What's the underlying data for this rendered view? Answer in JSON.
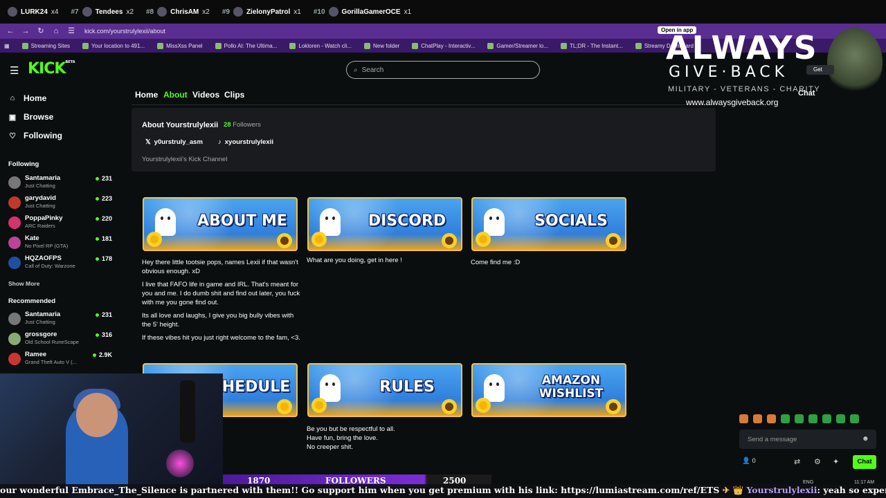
{
  "leaderboard": [
    {
      "rank": "",
      "name": "LURK24",
      "count": "x4"
    },
    {
      "rank": "#7",
      "name": "Tendees",
      "count": "x2"
    },
    {
      "rank": "#8",
      "name": "ChrisAM",
      "count": "x2"
    },
    {
      "rank": "#9",
      "name": "ZielonyPatrol",
      "count": "x1"
    },
    {
      "rank": "#10",
      "name": "GorillaGamerOCE",
      "count": "x1"
    }
  ],
  "browser": {
    "url": "kick.com/yourstrulylexii/about",
    "open_in_app": "Open in app"
  },
  "bookmarks": [
    "Streaming Sites",
    "Your location to 491...",
    "MissXss Panel",
    "Pollo AI: The Ultima...",
    "Lokloren - Watch cli...",
    "New folder",
    "ChatPlay - Interactiv...",
    "Gamer/Streamer lo...",
    "TL;DR - The Instant...",
    "Streamy Dashboard"
  ],
  "header": {
    "logo": "KICK",
    "logo_sup": "BETA",
    "search_placeholder": "Search"
  },
  "nav": {
    "home": "Home",
    "browse": "Browse",
    "following": "Following"
  },
  "following_section": {
    "title": "Following",
    "channels": [
      {
        "name": "Santamaria",
        "game": "Just Chatting",
        "viewers": "231",
        "color": "#777"
      },
      {
        "name": "garydavid",
        "game": "Just Chatting",
        "viewers": "223",
        "color": "#c0392b"
      },
      {
        "name": "PoppaPinky",
        "game": "ARC Raiders",
        "viewers": "220",
        "color": "#d6336c"
      },
      {
        "name": "Kate",
        "game": "No Pixel RP (GTA)",
        "viewers": "181",
        "color": "#b49"
      },
      {
        "name": "HQZAOFPS",
        "game": "Call of Duty: Warzone",
        "viewers": "178",
        "color": "#1f4fa0"
      }
    ],
    "show_more": "Show More"
  },
  "recommended_section": {
    "title": "Recommended",
    "channels": [
      {
        "name": "Santamaria",
        "game": "Just Chatting",
        "viewers": "231",
        "color": "#777"
      },
      {
        "name": "grossgore",
        "game": "Old School RuneScape",
        "viewers": "316",
        "color": "#8a7"
      },
      {
        "name": "Ramee",
        "game": "Grand Theft Auto V (...",
        "viewers": "2.9K",
        "color": "#c33"
      }
    ]
  },
  "tabs": {
    "home": "Home",
    "about": "About",
    "videos": "Videos",
    "clips": "Clips"
  },
  "about": {
    "title": "About Yourstrulylexii",
    "followers_count": "28",
    "followers_label": "Followers",
    "x_handle": "y0urstruly_asm",
    "tiktok_handle": "xyourstrulylexii",
    "description": "Yourstrulylexii's Kick Channel"
  },
  "panels": {
    "about_me": {
      "title": "ABOUT ME",
      "text": [
        "Hey there little tootsie pops, names Lexii if that wasn't obvious enough. xD",
        "I live that FAFO life in game and IRL. That's meant for you and me. I do dumb shit and find out later, you fuck with me you gone find out.",
        "Its all love and laughs, I give you big bully vibes with the 5' height.",
        "If these vibes hit you just right welcome to the fam, <3."
      ]
    },
    "discord": {
      "title": "DISCORD",
      "text": "What are you doing, get in here !"
    },
    "socials": {
      "title": "SOCIALS",
      "text": "Come find me :D"
    },
    "schedule": {
      "title": "HEDULE"
    },
    "rules": {
      "title": "RULES",
      "text": [
        "Be you but be respectful to all.",
        "Have fun, bring the love.",
        "No creeper shit."
      ]
    },
    "wishlist": {
      "title_line1": "AMAZON",
      "title_line2": "WISHLIST"
    }
  },
  "overlay": {
    "line1": "ALWAYS",
    "line2": "GIVE·BACK",
    "line3": "MILITARY - VETERANS - CHARITY",
    "url": "www.alwaysgiveback.org"
  },
  "chat": {
    "label": "Chat",
    "get_label": "Get",
    "placeholder": "Send a message",
    "viewers": "0",
    "button": "Chat"
  },
  "follower_goal": {
    "current": "1870",
    "label": "FOLLOWERS",
    "target": "2500"
  },
  "ticker": {
    "text": "our wonderful Embrace_The_Silence is partnered with them!! Go support him when you get premium with his link: https://lumiastream.com/ref/ETS",
    "user": "Yourstrulylexii",
    "message": ": yeah so expensive"
  },
  "taskbar": {
    "lang": "ENG",
    "time": "11:17 AM"
  }
}
